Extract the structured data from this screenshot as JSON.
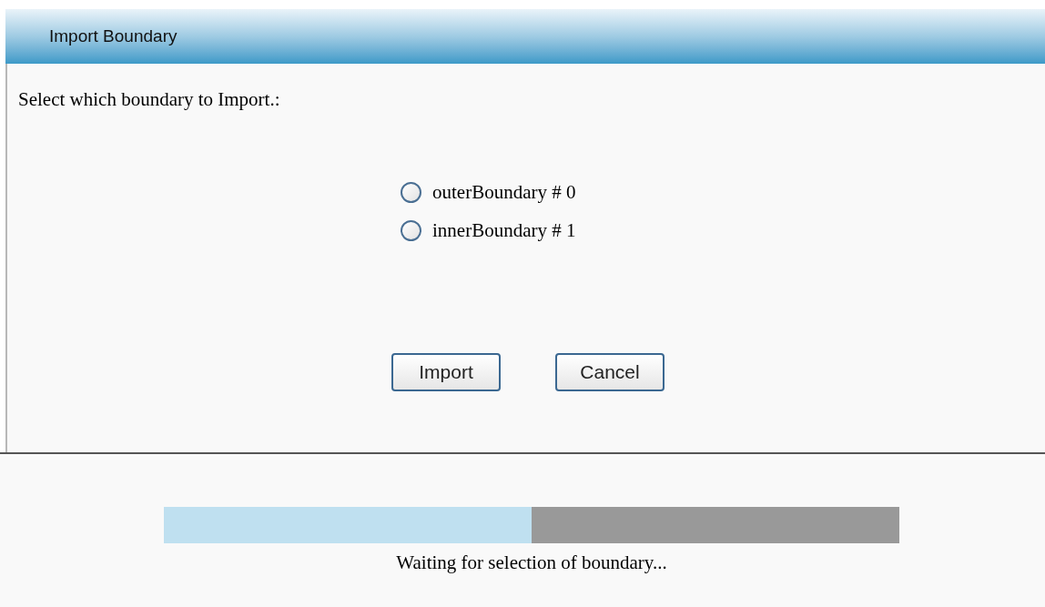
{
  "dialog": {
    "title": "Import Boundary"
  },
  "prompt": "Select which boundary to Import.:",
  "options": [
    {
      "label": "outerBoundary # 0",
      "selected": false
    },
    {
      "label": "innerBoundary # 1",
      "selected": false
    }
  ],
  "buttons": [
    "Import",
    "Cancel"
  ],
  "progress": {
    "level": 0.5,
    "status": "Waiting for selection of boundary..."
  }
}
